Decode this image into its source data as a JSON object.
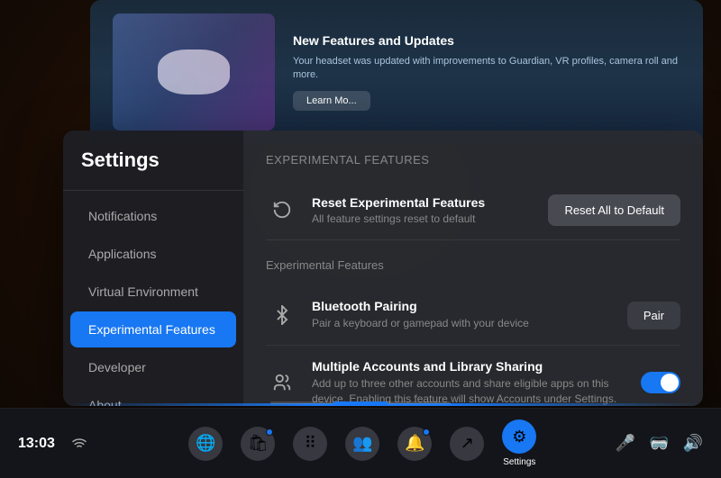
{
  "vr_background": {
    "color": "#2a1a0e"
  },
  "floating_screen": {
    "title": "New Features and Updates",
    "description": "Your headset was updated with improvements to Guardian, VR profiles, camera roll and more.",
    "learn_more_label": "Learn Mo..."
  },
  "sidebar": {
    "title": "Settings",
    "items": [
      {
        "id": "notifications",
        "label": "Notifications",
        "active": false
      },
      {
        "id": "applications",
        "label": "Applications",
        "active": false
      },
      {
        "id": "virtual-environment",
        "label": "Virtual Environment",
        "active": false
      },
      {
        "id": "experimental-features",
        "label": "Experimental Features",
        "active": true
      },
      {
        "id": "developer",
        "label": "Developer",
        "active": false
      },
      {
        "id": "about",
        "label": "About",
        "active": false
      }
    ]
  },
  "main_content": {
    "section_header_1": "Experimental Features",
    "reset_row": {
      "title": "Reset Experimental Features",
      "subtitle": "All feature settings reset to default",
      "button_label": "Reset All to Default"
    },
    "section_header_2": "Experimental Features",
    "features": [
      {
        "id": "bluetooth",
        "title": "Bluetooth Pairing",
        "subtitle": "Pair a keyboard or gamepad with your device",
        "control_type": "button",
        "button_label": "Pair"
      },
      {
        "id": "multiple-accounts",
        "title": "Multiple Accounts and Library Sharing",
        "subtitle": "Add up to three other accounts and share eligible apps on this device. Enabling this feature will show Accounts under Settings.",
        "control_type": "toggle",
        "toggle_on": true
      }
    ]
  },
  "taskbar": {
    "time": "13:03",
    "items": [
      {
        "id": "home",
        "icon": "🌐",
        "label": "",
        "active": false,
        "has_badge": false
      },
      {
        "id": "store",
        "icon": "🛍",
        "label": "",
        "active": false,
        "has_badge": true
      },
      {
        "id": "apps",
        "icon": "⠿",
        "label": "",
        "active": false,
        "has_badge": false
      },
      {
        "id": "people",
        "icon": "👥",
        "label": "",
        "active": false,
        "has_badge": false
      },
      {
        "id": "notifications",
        "icon": "🔔",
        "label": "",
        "active": false,
        "has_badge": true
      },
      {
        "id": "share",
        "icon": "↗",
        "label": "",
        "active": false,
        "has_badge": false
      },
      {
        "id": "settings",
        "icon": "⚙",
        "label": "Settings",
        "active": true,
        "has_badge": false
      }
    ],
    "bottom_items": [
      {
        "id": "mic",
        "icon": "🎤"
      },
      {
        "id": "vr",
        "icon": "🥽"
      },
      {
        "id": "volume",
        "icon": "🔊"
      }
    ]
  }
}
